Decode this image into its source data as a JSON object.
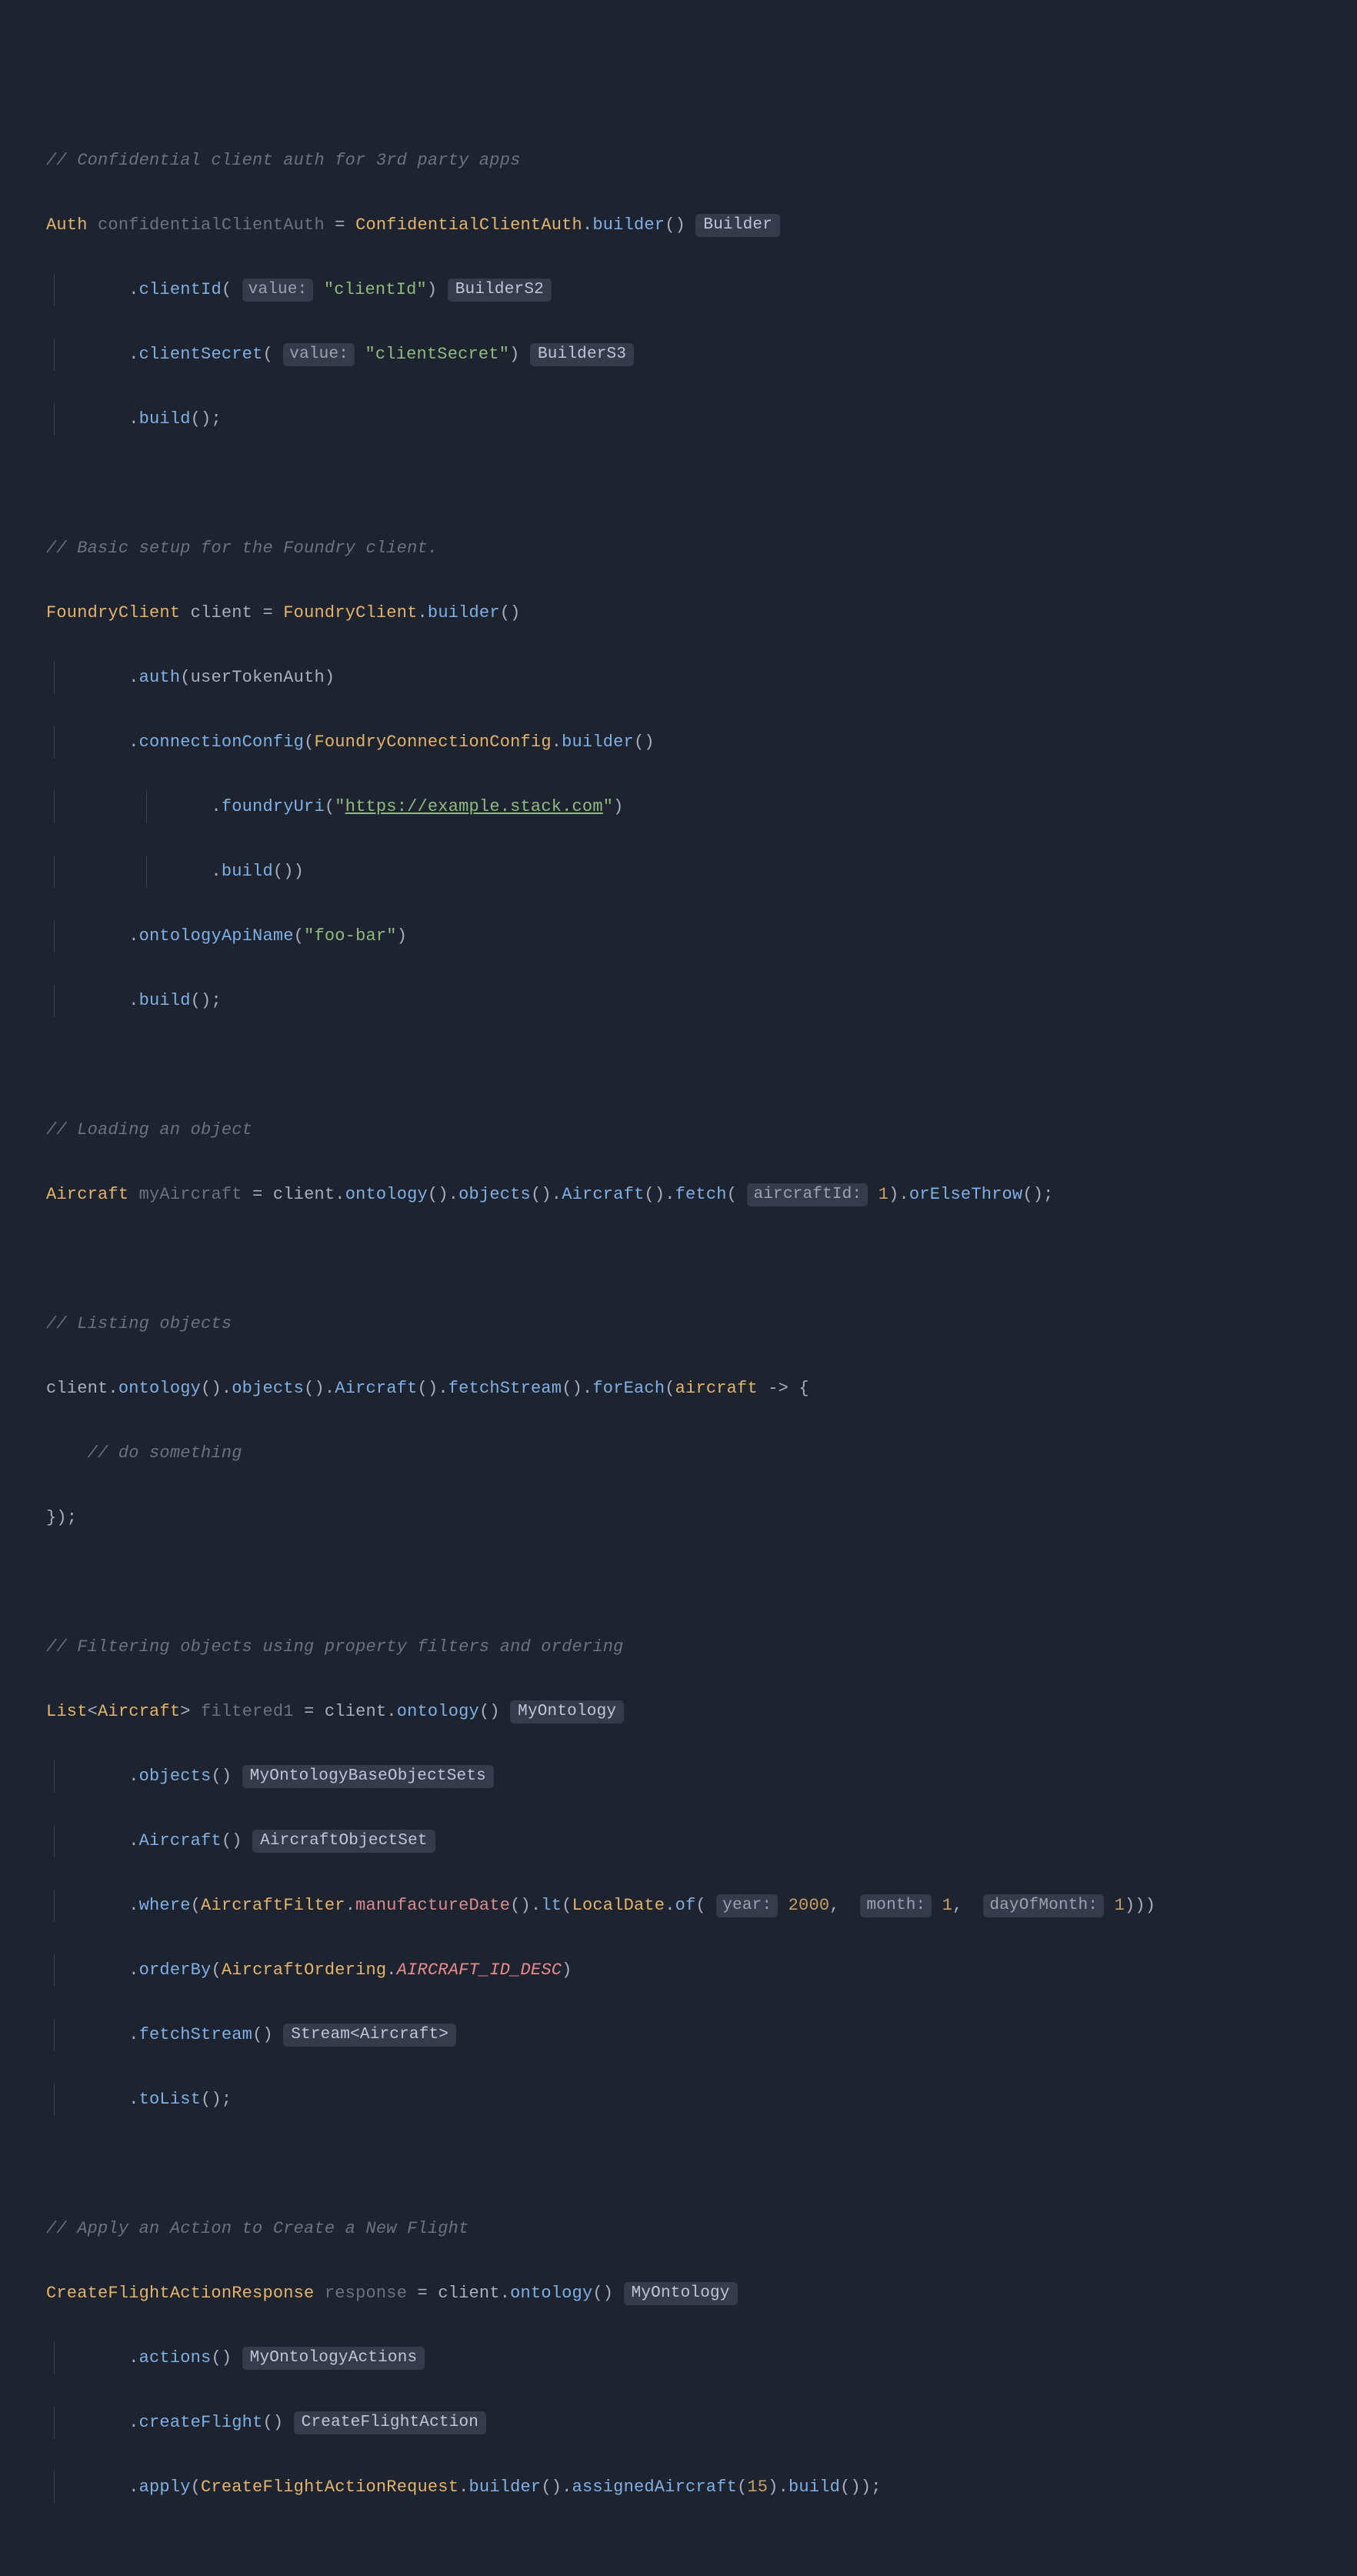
{
  "code": {
    "comments": {
      "c1": "// Confidential client auth for 3rd party apps",
      "c2": "// Basic setup for the Foundry client.",
      "c3": "// Loading an object",
      "c4": "// Listing objects",
      "c5": "// do something",
      "c6": "// Filtering objects using property filters and ordering",
      "c7": "// Apply an Action to Create a New Flight"
    },
    "types": {
      "Auth": "Auth",
      "ConfidentialClientAuth": "ConfidentialClientAuth",
      "FoundryClient": "FoundryClient",
      "FoundryConnectionConfig": "FoundryConnectionConfig",
      "Aircraft": "Aircraft",
      "List": "List",
      "AircraftFilter": "AircraftFilter",
      "LocalDate": "LocalDate",
      "AircraftOrdering": "AircraftOrdering",
      "CreateFlightActionResponse": "CreateFlightActionResponse",
      "CreateFlightActionRequest": "CreateFlightActionRequest"
    },
    "vars": {
      "confidentialClientAuth": "confidentialClientAuth",
      "client": "client",
      "userTokenAuth": "userTokenAuth",
      "myAircraft": "myAircraft",
      "aircraft": "aircraft",
      "filtered1": "filtered1",
      "response": "response"
    },
    "methods": {
      "builder": "builder",
      "clientId": "clientId",
      "clientSecret": "clientSecret",
      "build": "build",
      "auth": "auth",
      "connectionConfig": "connectionConfig",
      "foundryUri": "foundryUri",
      "ontologyApiName": "ontologyApiName",
      "ontology": "ontology",
      "objects": "objects",
      "AircraftM": "Aircraft",
      "fetch": "fetch",
      "orElseThrow": "orElseThrow",
      "fetchStream": "fetchStream",
      "forEach": "forEach",
      "where": "where",
      "manufactureDate": "manufactureDate",
      "lt": "lt",
      "of": "of",
      "orderBy": "orderBy",
      "toList": "toList",
      "actions": "actions",
      "createFlight": "createFlight",
      "apply": "apply",
      "assignedAircraft": "assignedAircraft"
    },
    "strings": {
      "clientId": "\"clientId\"",
      "clientSecret": "\"clientSecret\"",
      "uri_q1": "\"",
      "uri": "https://example.stack.com",
      "uri_q2": "\"",
      "foobar": "\"foo-bar\""
    },
    "numbers": {
      "one": "1",
      "y2000": "2000",
      "fifteen": "15"
    },
    "constants": {
      "AIRCRAFT_ID_DESC": "AIRCRAFT_ID_DESC"
    },
    "inlays": {
      "Builder": "Builder",
      "BuilderS2": "BuilderS2",
      "BuilderS3": "BuilderS3",
      "value": "value:",
      "aircraftId": "aircraftId:",
      "MyOntology": "MyOntology",
      "MyOntologyBaseObjectSets": "MyOntologyBaseObjectSets",
      "AircraftObjectSet": "AircraftObjectSet",
      "year": "year:",
      "month": "month:",
      "dayOfMonth": "dayOfMonth:",
      "StreamAircraft": "Stream<Aircraft>",
      "MyOntologyActions": "MyOntologyActions",
      "CreateFlightAction": "CreateFlightAction"
    },
    "punct": {
      "eq": " = ",
      "dot": ".",
      "lp": "(",
      "rp": ")",
      "sc": ";",
      "co": ",",
      "ar": " -> {",
      "rb": "});",
      "la": "<",
      "ra": ">",
      "sp": " "
    }
  }
}
